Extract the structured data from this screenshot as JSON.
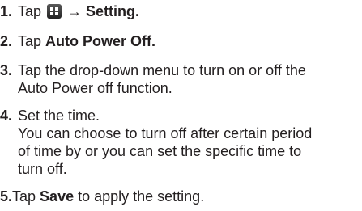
{
  "steps": [
    {
      "number": "1.",
      "before": "Tap ",
      "icon": "menu-grid-icon",
      "after": " → ",
      "bold": "Setting."
    },
    {
      "number": "2.",
      "before": "Tap ",
      "bold": "Auto Power Off."
    },
    {
      "number": "3.",
      "line1": "Tap the drop-down menu to turn on or off the",
      "line2": "Auto Power off function."
    },
    {
      "number": "4.",
      "line1": "Set the time.",
      "line2": "You can choose to turn off after certain period",
      "line3": "of time by or you can set the specific time to",
      "line4": "turn off."
    },
    {
      "number": "5.",
      "before": "Tap ",
      "bold": "Save",
      "after": " to apply the setting."
    }
  ]
}
